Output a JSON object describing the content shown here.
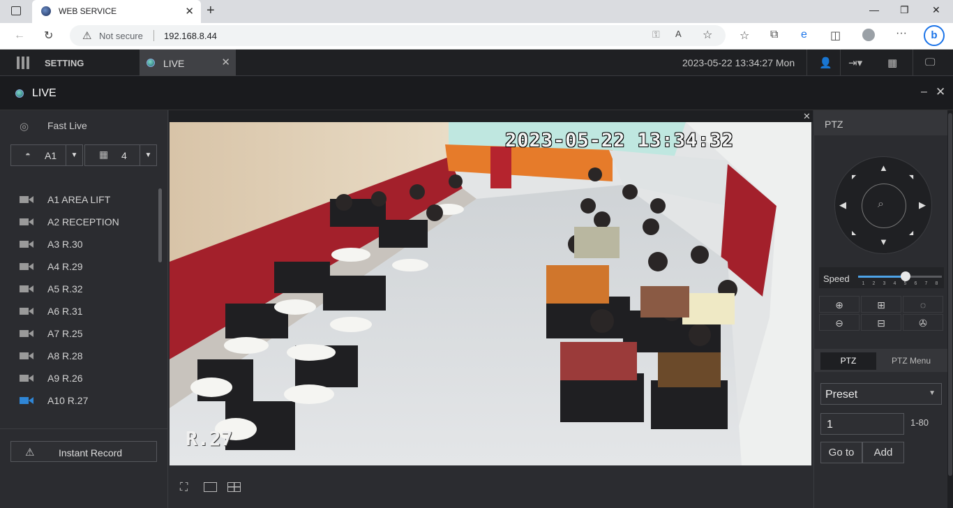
{
  "browser": {
    "tab_title": "WEB SERVICE",
    "address_security": "Not secure",
    "address_url": "192.168.8.44"
  },
  "app_header": {
    "setting_label": "SETTING",
    "live_tab_label": "LIVE",
    "datetime": "2023-05-22 13:34:27 Mon"
  },
  "live_panel": {
    "title": "LIVE"
  },
  "left_panel": {
    "fast_live": "Fast Live",
    "select_a": "A1",
    "select_layout": "4",
    "channels": [
      {
        "label": "A1 AREA LIFT",
        "active": false
      },
      {
        "label": "A2 RECEPTION",
        "active": false
      },
      {
        "label": "A3 R.30",
        "active": false
      },
      {
        "label": "A4 R.29",
        "active": false
      },
      {
        "label": "A5 R.32",
        "active": false
      },
      {
        "label": "A6 R.31",
        "active": false
      },
      {
        "label": "A7 R.25",
        "active": false
      },
      {
        "label": "A8 R.28",
        "active": false
      },
      {
        "label": "A9 R.26",
        "active": false
      },
      {
        "label": "A10 R.27",
        "active": true
      }
    ],
    "instant_record": "Instant Record"
  },
  "video": {
    "osd_timestamp": "2023-05-22 13:34:32",
    "osd_label": "R.27"
  },
  "ptz": {
    "header": "PTZ",
    "speed_label": "Speed",
    "speed_value": 5,
    "speed_max": 8,
    "speed_ticks": [
      "1",
      "2",
      "3",
      "4",
      "5",
      "6",
      "7",
      "8"
    ],
    "tab_ptz": "PTZ",
    "tab_menu": "PTZ Menu",
    "preset_label": "Preset",
    "preset_value": "1",
    "preset_range": "1-80",
    "goto_label": "Go to",
    "add_label": "Add"
  },
  "colors": {
    "accent": "#4da3e8",
    "active_channel_icon": "#2f86d6"
  }
}
